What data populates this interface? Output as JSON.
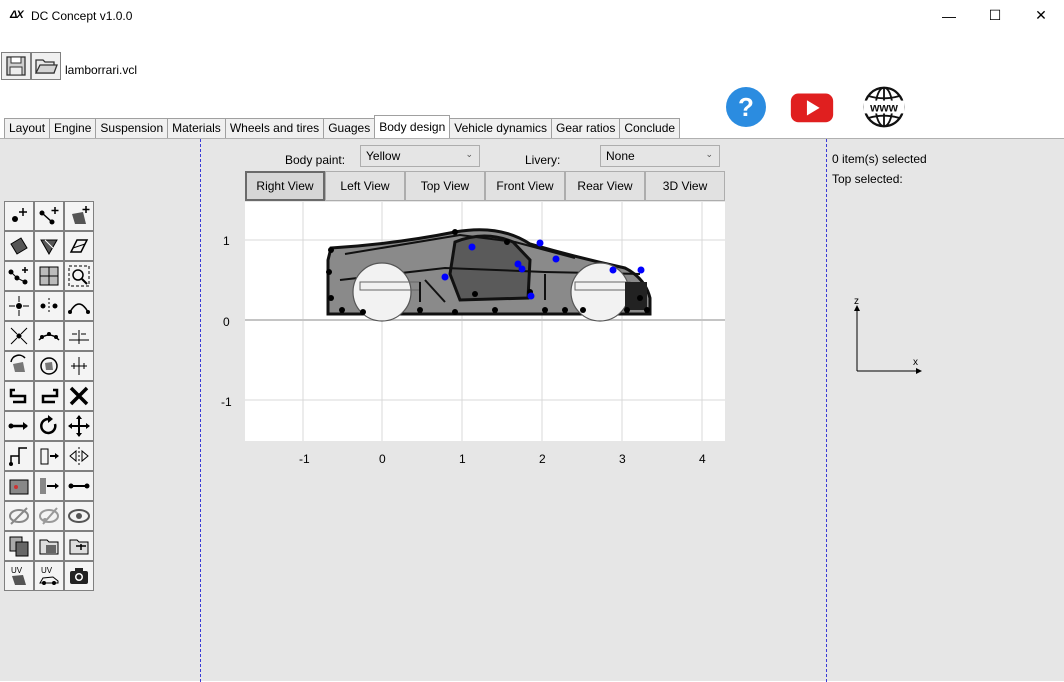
{
  "window": {
    "logo": "ΔX",
    "title": "DC Concept v1.0.0",
    "controls": {
      "minimize": "—",
      "maximize": "☐",
      "close": "✕"
    }
  },
  "toolbar": {
    "file_name": "lamborrari.vcl",
    "icons": [
      "save-icon",
      "open-folder-icon",
      "help-icon",
      "youtube-icon",
      "website-icon"
    ],
    "help_glyph": "?",
    "web_text": "www"
  },
  "tabs": [
    {
      "label": "Layout",
      "active": false
    },
    {
      "label": "Engine",
      "active": false
    },
    {
      "label": "Suspension",
      "active": false
    },
    {
      "label": "Materials",
      "active": false
    },
    {
      "label": "Wheels and tires",
      "active": false
    },
    {
      "label": "Guages",
      "active": false
    },
    {
      "label": "Body design",
      "active": true
    },
    {
      "label": "Vehicle dynamics",
      "active": false
    },
    {
      "label": "Gear ratios",
      "active": false
    },
    {
      "label": "Conclude",
      "active": false
    }
  ],
  "body_design": {
    "body_paint_label": "Body paint:",
    "body_paint_value": "Yellow",
    "livery_label": "Livery:",
    "livery_value": "None",
    "views": [
      "Right View",
      "Left View",
      "Top View",
      "Front View",
      "Rear View",
      "3D View"
    ],
    "active_view": "Right View",
    "x_ticks": [
      "-1",
      "0",
      "1",
      "2",
      "3",
      "4"
    ],
    "y_ticks": [
      "1",
      "0",
      "-1"
    ],
    "tools": [
      "add-point-icon",
      "add-segment-icon",
      "add-face-icon",
      "fill-quad-icon",
      "fill-tri-icon",
      "edit-face-icon",
      "connect-points-icon",
      "grid-icon",
      "zoom-select-icon",
      "merge-points-icon",
      "split-points-icon",
      "curve-icon",
      "collapse-icon",
      "smooth-curve-icon",
      "mirror-edge-icon",
      "rotate-face-icon",
      "rotate-all-icon",
      "align-icon",
      "undo-icon",
      "redo-icon",
      "delete-icon",
      "move-x-icon",
      "rotate-icon",
      "move-all-icon",
      "extrude-icon",
      "flip-icon",
      "mirror-icon",
      "layer-icon",
      "stretch-icon",
      "move-line-icon",
      "hide-icon",
      "hide-selected-icon",
      "show-icon",
      "copy-layer-icon",
      "paste-layer-icon",
      "duplicate-icon",
      "uv-face-icon",
      "uv-car-icon",
      "screenshot-icon"
    ]
  },
  "selection": {
    "count_text": "0 item(s) selected",
    "top_text": "Top selected:"
  },
  "gizmo": {
    "vertical_axis": "z",
    "horizontal_axis": "x"
  },
  "colors": {
    "accent_help": "#2b8ce0",
    "youtube_red": "#e01f1f",
    "separator": "#3b3bd6",
    "point_blue": "#0000ff"
  }
}
